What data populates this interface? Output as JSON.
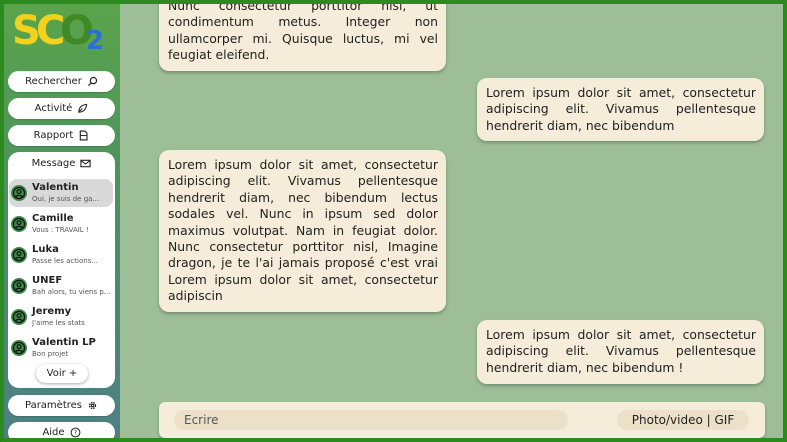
{
  "app": {
    "logo_text": "SCO2"
  },
  "nav": {
    "search": "Rechercher",
    "activity": "Activité",
    "report": "Rapport",
    "messages": "Message",
    "settings": "Paramètres",
    "help": "Aide"
  },
  "conversations": [
    {
      "name": "Valentin",
      "preview": "Oui, je suis de ga...",
      "active": true
    },
    {
      "name": "Camille",
      "preview": "Vous : TRAVAIL !"
    },
    {
      "name": "Luka",
      "preview": "Passe les actions..."
    },
    {
      "name": "UNEF",
      "preview": "Bah alors, tu viens p..."
    },
    {
      "name": "Jeremy",
      "preview": "J'aime les stats"
    },
    {
      "name": "Valentin LP",
      "preview": "Bon projet"
    }
  ],
  "see_more": "Voir +",
  "messages": [
    {
      "direction": "received",
      "text": "Nunc consectetur porttitor nisl, ut condimentum metus. Integer non ullamcorper mi. Quisque luctus, mi vel feugiat eleifend."
    },
    {
      "direction": "sent",
      "text": "Lorem ipsum dolor sit amet, consectetur adipiscing elit. Vivamus pellentesque hendrerit diam, nec bibendum"
    },
    {
      "direction": "received",
      "text": "Lorem ipsum dolor sit amet, consectetur adipiscing elit. Vivamus pellentesque hendrerit diam, nec bibendum lectus sodales vel. Nunc in ipsum sed dolor maximus volutpat. Nam in feugiat dolor. Nunc consectetur porttitor nisl, Imagine dragon, je te l'ai jamais proposé c'est vrai Lorem ipsum dolor sit amet, consectetur adipiscin"
    },
    {
      "direction": "sent",
      "text": "Lorem ipsum dolor sit amet, consectetur adipiscing elit. Vivamus pellentesque hendrerit diam, nec bibendum !"
    }
  ],
  "composer": {
    "placeholder": "Ecrire",
    "media_button": "Photo/video | GIF"
  },
  "colors": {
    "frame": "#2c8a1e",
    "chat_background": "#9dbe97",
    "bubble": "#f5ecd9",
    "avatar": "#3b8a47"
  }
}
